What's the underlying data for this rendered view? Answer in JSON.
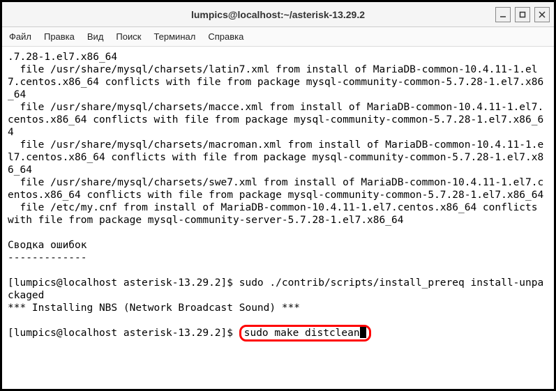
{
  "titlebar": {
    "title": "lumpics@localhost:~/asterisk-13.29.2"
  },
  "menubar": {
    "file": "Файл",
    "edit": "Правка",
    "view": "Вид",
    "search": "Поиск",
    "terminal": "Терминал",
    "help": "Справка"
  },
  "terminal": {
    "output_line1": ".7.28-1.el7.x86_64",
    "output_line2": "  file /usr/share/mysql/charsets/latin7.xml from install of MariaDB-common-10.4.11-1.el7.centos.x86_64 conflicts with file from package mysql-community-common-5.7.28-1.el7.x86_64",
    "output_line3": "  file /usr/share/mysql/charsets/macce.xml from install of MariaDB-common-10.4.11-1.el7.centos.x86_64 conflicts with file from package mysql-community-common-5.7.28-1.el7.x86_64",
    "output_line4": "  file /usr/share/mysql/charsets/macroman.xml from install of MariaDB-common-10.4.11-1.el7.centos.x86_64 conflicts with file from package mysql-community-common-5.7.28-1.el7.x86_64",
    "output_line5": "  file /usr/share/mysql/charsets/swe7.xml from install of MariaDB-common-10.4.11-1.el7.centos.x86_64 conflicts with file from package mysql-community-common-5.7.28-1.el7.x86_64",
    "output_line6": "  file /etc/my.cnf from install of MariaDB-common-10.4.11-1.el7.centos.x86_64 conflicts with file from package mysql-community-server-5.7.28-1.el7.x86_64",
    "output_blank1": "",
    "output_line7": "Сводка ошибок",
    "output_line8": "-------------",
    "output_blank2": "",
    "output_line9": "[lumpics@localhost asterisk-13.29.2]$ sudo ./contrib/scripts/install_prereq install-unpackaged",
    "output_line10": "*** Installing NBS (Network Broadcast Sound) ***",
    "output_blank3": "",
    "prompt": "[lumpics@localhost asterisk-13.29.2]$ ",
    "command": "sudo make distclean"
  }
}
